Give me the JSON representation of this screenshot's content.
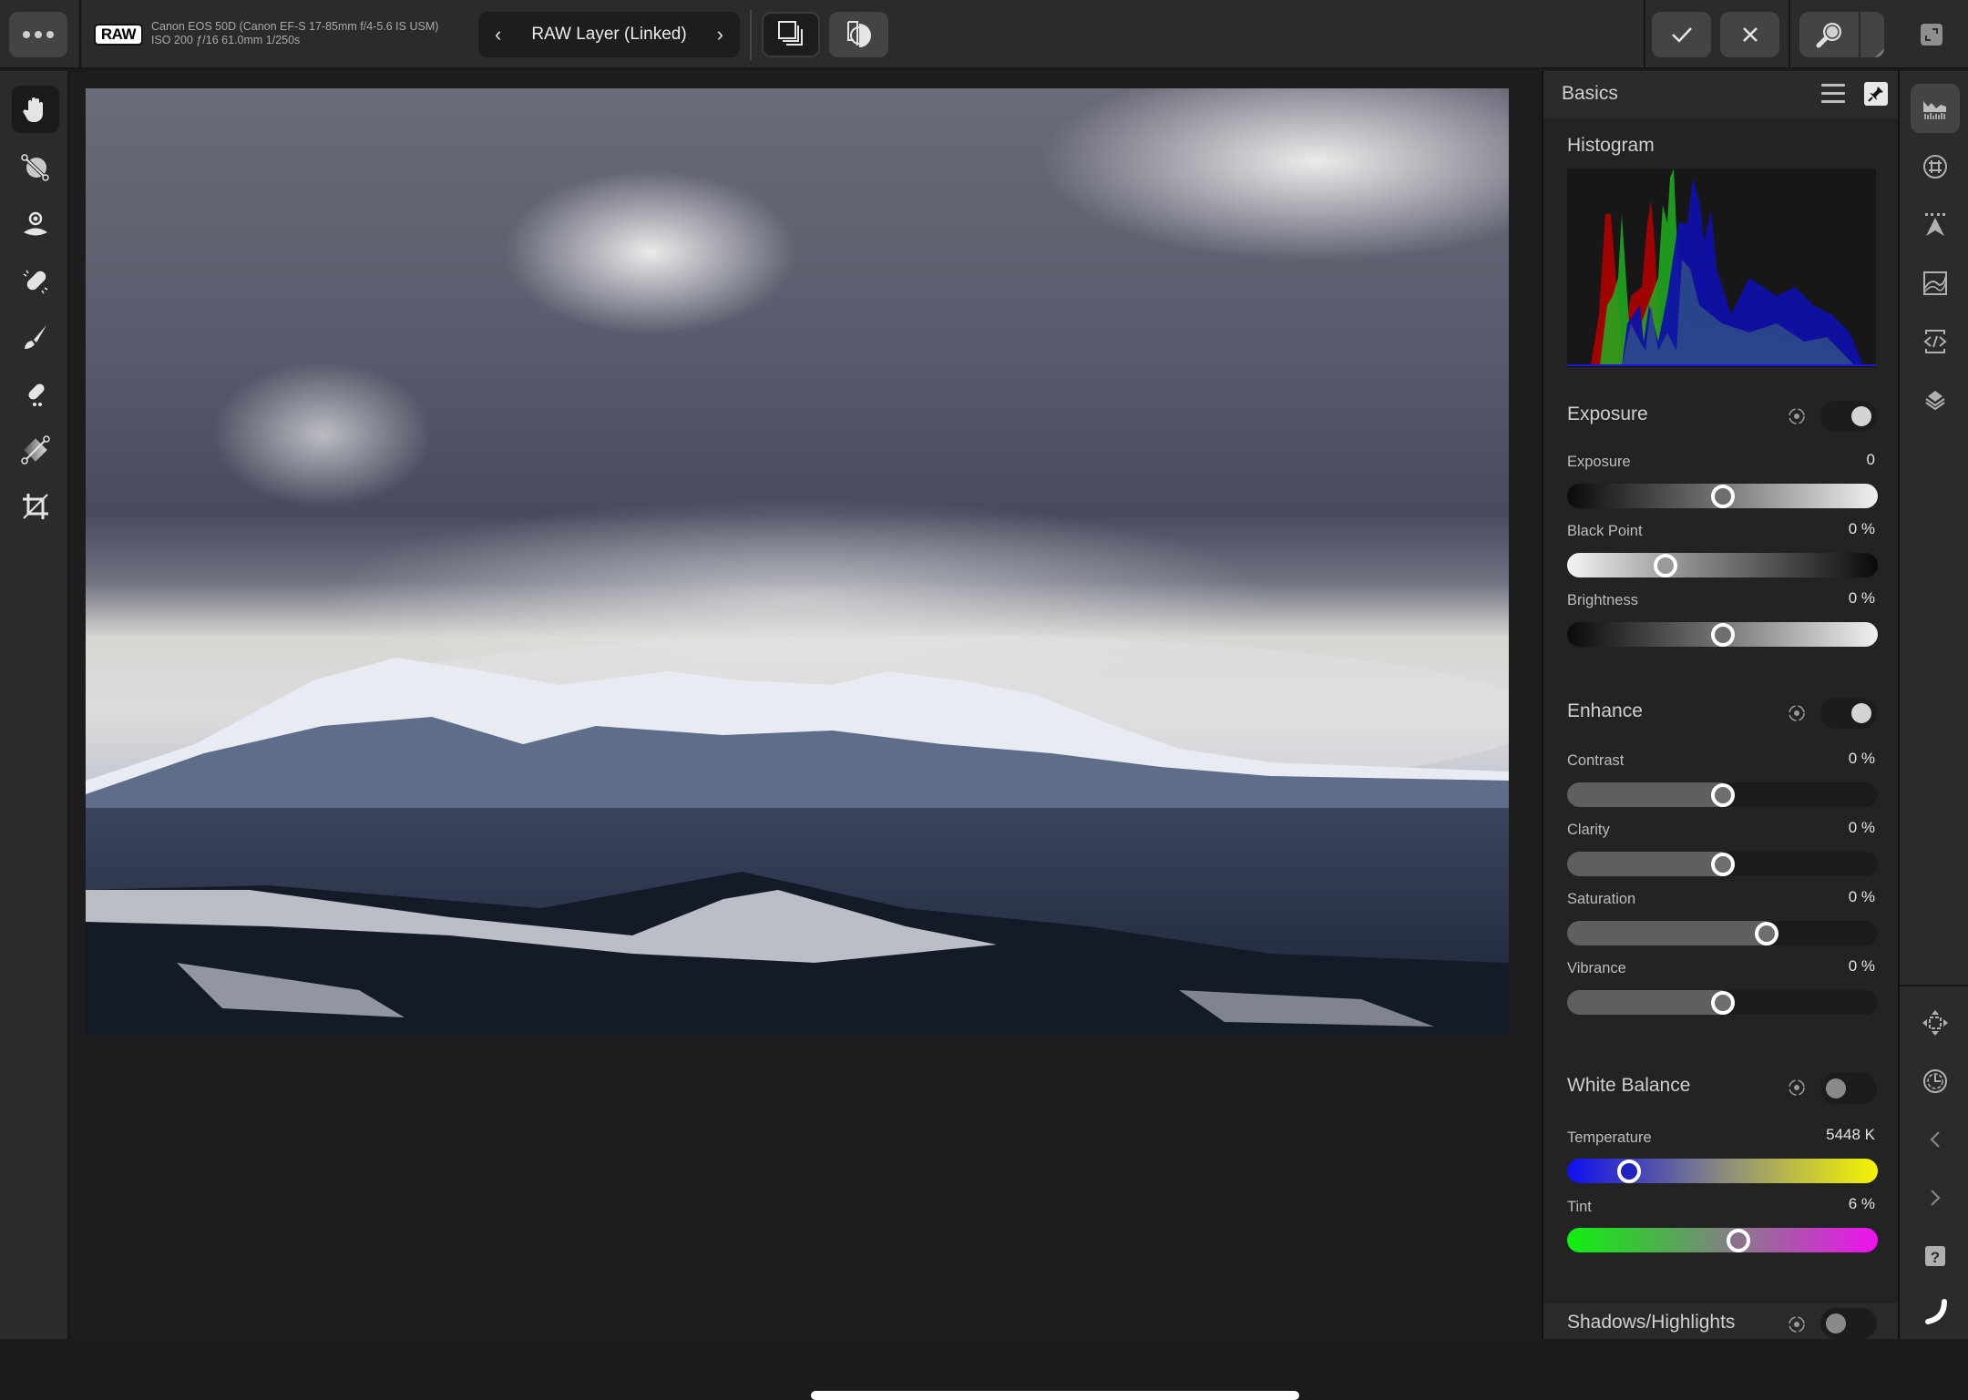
{
  "toolbar": {
    "menu_icon": "more-dots-icon",
    "raw_badge": "RAW",
    "camera_line1": "Canon EOS 50D (Canon EF-S 17-85mm f/4-5.6 IS USM)",
    "camera_line2": "ISO 200 ƒ/16 61.0mm 1/250s",
    "layer_prev": "‹",
    "layer_title": "RAW Layer (Linked)",
    "layer_next": "›",
    "buttons": [
      "layers-overlay",
      "split-view",
      "apply",
      "cancel",
      "zoom",
      "fullscreen"
    ]
  },
  "left_tools": [
    {
      "name": "hand-tool",
      "active": true
    },
    {
      "name": "red-eye-tool",
      "active": false
    },
    {
      "name": "radial-mask-tool",
      "active": false
    },
    {
      "name": "blemish-removal-tool",
      "active": false
    },
    {
      "name": "brush-tool",
      "active": false
    },
    {
      "name": "erase-tool",
      "active": false
    },
    {
      "name": "gradient-mask-tool",
      "active": false
    },
    {
      "name": "crop-tool",
      "active": false
    }
  ],
  "panel": {
    "title": "Basics",
    "histogram_title": "Histogram",
    "sections": {
      "exposure": {
        "title": "Exposure",
        "enabled": true,
        "sliders": [
          {
            "label": "Exposure",
            "value": "0",
            "position": 0.5
          },
          {
            "label": "Black Point",
            "value": "0 %",
            "position": 0.3
          },
          {
            "label": "Brightness",
            "value": "0 %",
            "position": 0.5
          }
        ]
      },
      "enhance": {
        "title": "Enhance",
        "enabled": true,
        "sliders": [
          {
            "label": "Contrast",
            "value": "0 %",
            "position": 0.5
          },
          {
            "label": "Clarity",
            "value": "0 %",
            "position": 0.5
          },
          {
            "label": "Saturation",
            "value": "0 %",
            "position": 0.655
          },
          {
            "label": "Vibrance",
            "value": "0 %",
            "position": 0.5
          }
        ]
      },
      "white_balance": {
        "title": "White Balance",
        "enabled": false,
        "sliders": [
          {
            "label": "Temperature",
            "value": "5448 K",
            "position": 0.175
          },
          {
            "label": "Tint",
            "value": "6 %",
            "position": 0.555
          }
        ]
      },
      "shadows_highlights": {
        "title": "Shadows/Highlights",
        "enabled": false
      }
    }
  },
  "right_strip": {
    "top": [
      "basics-histogram",
      "lens-grid",
      "details-sharpen",
      "tones-curve",
      "profiles-code",
      "layers"
    ],
    "bottom": [
      "navigator-move",
      "history-clock",
      "undo-back",
      "redo-forward",
      "help",
      "context-curve"
    ]
  },
  "colors": {
    "hist_red": "#c00000",
    "hist_green": "#20c020",
    "hist_blue": "#1010b0",
    "hist_gray_blue": "#2a4a8a"
  }
}
